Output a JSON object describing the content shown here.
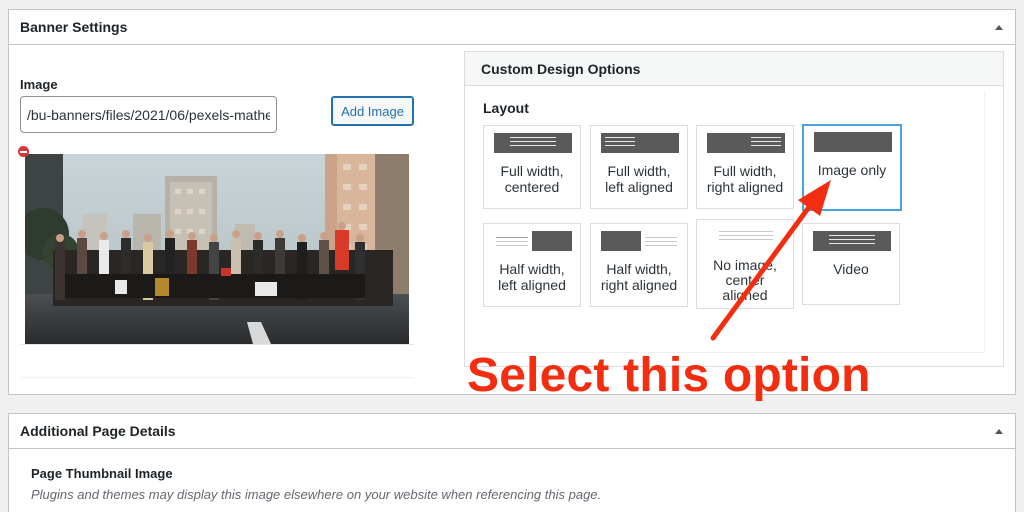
{
  "banner_settings": {
    "title": "Banner Settings",
    "image_label": "Image",
    "image_url_value": "/bu-banners/files/2021/06/pexels-mathe",
    "add_image_label": "Add Image"
  },
  "custom_design": {
    "title": "Custom Design Options",
    "layout_label": "Layout",
    "options": [
      {
        "label": "Full width,\ncentered",
        "selected": false
      },
      {
        "label": "Full width,\nleft aligned",
        "selected": false
      },
      {
        "label": "Full width,\nright aligned",
        "selected": false
      },
      {
        "label": "Image only",
        "selected": true
      },
      {
        "label": "Half width,\nleft aligned",
        "selected": false
      },
      {
        "label": "Half width,\nright aligned",
        "selected": false
      },
      {
        "label": "No image,\ncenter\naligned",
        "selected": false
      },
      {
        "label": "Video",
        "selected": false
      }
    ]
  },
  "annotation": {
    "text": "Select this option",
    "color": "#f22d10"
  },
  "page_details": {
    "title": "Additional Page Details",
    "thumbnail_label": "Page Thumbnail Image",
    "thumbnail_desc": "Plugins and themes may display this image elsewhere on your website when referencing this page."
  }
}
